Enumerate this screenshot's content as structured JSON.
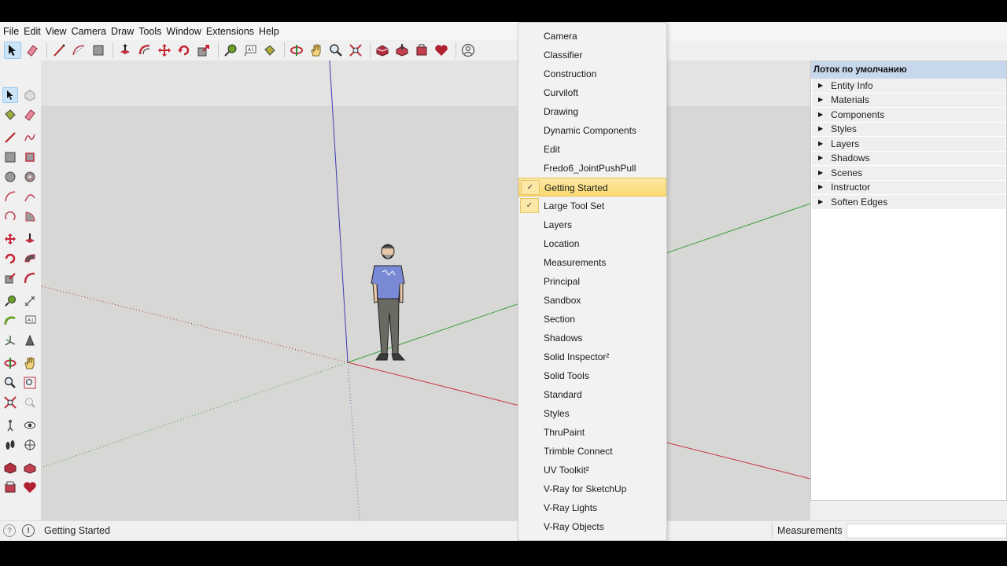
{
  "menubar": {
    "items": [
      "File",
      "Edit",
      "View",
      "Camera",
      "Draw",
      "Tools",
      "Window",
      "Extensions",
      "Help"
    ]
  },
  "toolbar_dropdown": {
    "items": [
      {
        "label": "Camera",
        "checked": false
      },
      {
        "label": "Classifier",
        "checked": false
      },
      {
        "label": "Construction",
        "checked": false
      },
      {
        "label": "Curviloft",
        "checked": false
      },
      {
        "label": "Drawing",
        "checked": false
      },
      {
        "label": "Dynamic Components",
        "checked": false
      },
      {
        "label": "Edit",
        "checked": false
      },
      {
        "label": "Fredo6_JointPushPull",
        "checked": false
      },
      {
        "label": "Getting Started",
        "checked": true,
        "highlighted": true
      },
      {
        "label": "Large Tool Set",
        "checked": true
      },
      {
        "label": "Layers",
        "checked": false
      },
      {
        "label": "Location",
        "checked": false
      },
      {
        "label": "Measurements",
        "checked": false
      },
      {
        "label": "Principal",
        "checked": false
      },
      {
        "label": "Sandbox",
        "checked": false
      },
      {
        "label": "Section",
        "checked": false
      },
      {
        "label": "Shadows",
        "checked": false
      },
      {
        "label": "Solid Inspector²",
        "checked": false
      },
      {
        "label": "Solid Tools",
        "checked": false
      },
      {
        "label": "Standard",
        "checked": false
      },
      {
        "label": "Styles",
        "checked": false
      },
      {
        "label": "ThruPaint",
        "checked": false
      },
      {
        "label": "Trimble Connect",
        "checked": false
      },
      {
        "label": "UV Toolkit²",
        "checked": false
      },
      {
        "label": "V-Ray for SketchUp",
        "checked": false
      },
      {
        "label": "V-Ray Lights",
        "checked": false
      },
      {
        "label": "V-Ray Objects",
        "checked": false
      }
    ],
    "check_glyph": "✓"
  },
  "tray": {
    "title": "Лоток по умолчанию",
    "items": [
      "Entity Info",
      "Materials",
      "Components",
      "Styles",
      "Layers",
      "Shadows",
      "Scenes",
      "Instructor",
      "Soften Edges"
    ]
  },
  "status": {
    "text": "Getting Started",
    "measurements_label": "Measurements",
    "measurements_value": ""
  },
  "colors": {
    "axis_red": "#c8323c",
    "axis_green": "#3ca03c",
    "axis_blue": "#3c3cb4",
    "highlight": "#f9d96e",
    "tray_title_bg": "#c7d8ec"
  }
}
